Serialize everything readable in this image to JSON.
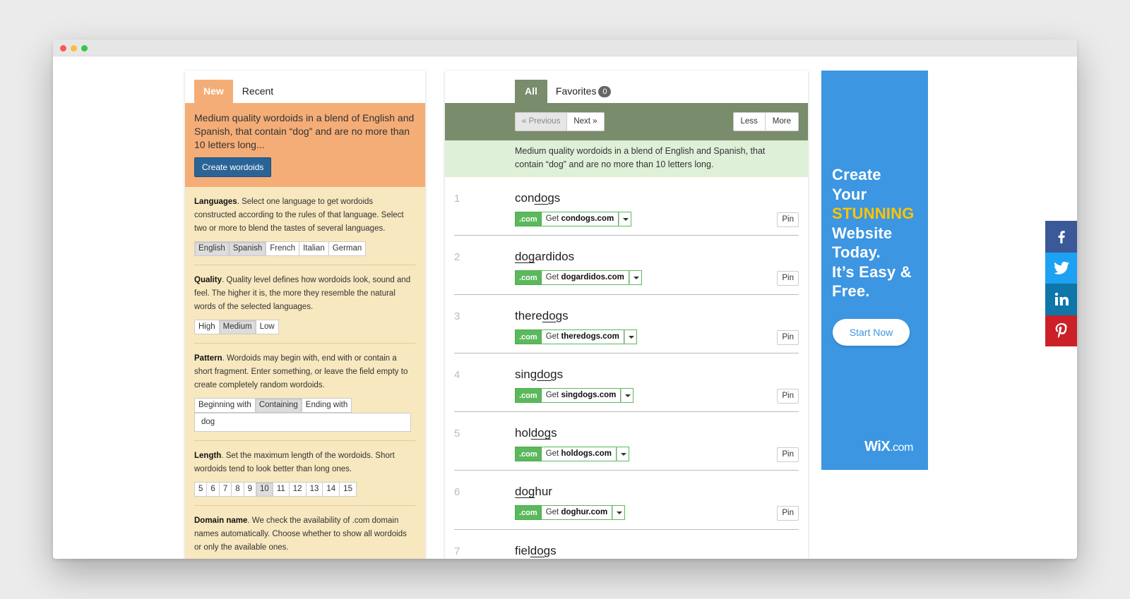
{
  "left": {
    "tabs": [
      "New",
      "Recent"
    ],
    "intro": "Medium quality wordoids in a blend of English and Spanish, that contain “dog” and are no more than 10 letters long...",
    "create_button": "Create wordoids",
    "languages": {
      "title": "Languages",
      "text": ". Select one language to get wordoids constructed according to the rules of that language. Select two or more to blend the tastes of several languages.",
      "options": [
        "English",
        "Spanish",
        "French",
        "Italian",
        "German"
      ],
      "selected": [
        "English",
        "Spanish"
      ]
    },
    "quality": {
      "title": "Quality",
      "text": ". Quality level defines how wordoids look, sound and feel. The higher it is, the more they resemble the natural words of the selected languages.",
      "options": [
        "High",
        "Medium",
        "Low"
      ],
      "selected": "Medium"
    },
    "pattern": {
      "title": "Pattern",
      "text": ". Wordoids may begin with, end with or contain a short fragment. Enter something, or leave the field empty to create completely random wordoids.",
      "options": [
        "Beginning with",
        "Containing",
        "Ending with"
      ],
      "selected": "Containing",
      "value": "dog"
    },
    "length": {
      "title": "Length",
      "text": ". Set the maximum length of the wordoids. Short wordoids tend to look better than long ones.",
      "options": [
        "5",
        "6",
        "7",
        "8",
        "9",
        "10",
        "11",
        "12",
        "13",
        "14",
        "15"
      ],
      "selected": "10"
    },
    "domain": {
      "title": "Domain name",
      "text": ". We check the availability of .com domain names automatically. Choose whether to show all wordoids or only the available ones."
    }
  },
  "mid": {
    "tab_all": "All",
    "tab_favorites": "Favorites",
    "favorites_count": "0",
    "prev": "« Previous",
    "next": "Next »",
    "less": "Less",
    "more": "More",
    "description": "Medium quality wordoids in a blend of English and Spanish, that contain “dog” and are no more than 10 letters long.",
    "tld": ".com",
    "get_label": "Get",
    "pin_label": "Pin",
    "results": [
      {
        "n": "1",
        "pre": "con",
        "match": "dog",
        "post": "s",
        "domain": "condogs.com"
      },
      {
        "n": "2",
        "pre": "",
        "match": "dog",
        "post": "ardidos",
        "domain": "dogardidos.com"
      },
      {
        "n": "3",
        "pre": "there",
        "match": "dog",
        "post": "s",
        "domain": "theredogs.com"
      },
      {
        "n": "4",
        "pre": "sing",
        "match": "dog",
        "post": "s",
        "domain": "singdogs.com"
      },
      {
        "n": "5",
        "pre": "hol",
        "match": "dog",
        "post": "s",
        "domain": "holdogs.com"
      },
      {
        "n": "6",
        "pre": "",
        "match": "dog",
        "post": "hur",
        "domain": "doghur.com"
      },
      {
        "n": "7",
        "pre": "fiel",
        "match": "dog",
        "post": "s",
        "domain": ""
      }
    ]
  },
  "ad": {
    "line1": "Create",
    "line2": "Your",
    "line3": "STUNNING",
    "line4": "Website",
    "line5": "Today.",
    "line6": "It’s Easy &",
    "line7": "Free.",
    "button": "Start Now",
    "logo_main": "WiX",
    "logo_suffix": ".com",
    "bg_color": "#3c96e1",
    "highlight_color": "#ffc400"
  },
  "social": [
    "facebook-icon",
    "twitter-icon",
    "linkedin-icon",
    "pinterest-icon"
  ]
}
